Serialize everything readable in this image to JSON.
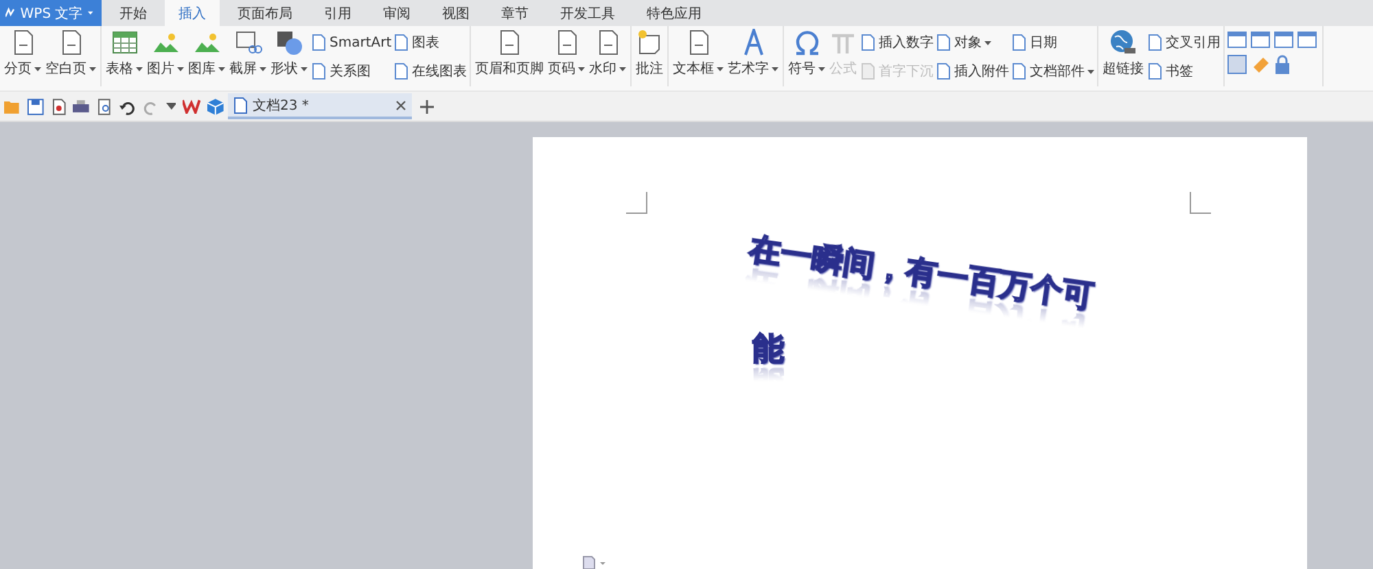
{
  "app_button": {
    "label": "WPS 文字",
    "dropdown": true
  },
  "tabs": [
    {
      "label": "开始",
      "selected": false
    },
    {
      "label": "插入",
      "selected": true
    },
    {
      "label": "页面布局",
      "selected": false
    },
    {
      "label": "引用",
      "selected": false
    },
    {
      "label": "审阅",
      "selected": false
    },
    {
      "label": "视图",
      "selected": false
    },
    {
      "label": "章节",
      "selected": false
    },
    {
      "label": "开发工具",
      "selected": false
    },
    {
      "label": "特色应用",
      "selected": false
    }
  ],
  "ribbon": {
    "groups": [
      {
        "columns": [
          {
            "kind": "large",
            "label": "分页",
            "dropdown": true,
            "disabled": false
          },
          {
            "kind": "large",
            "label": "空白页",
            "dropdown": true,
            "disabled": false
          }
        ]
      },
      {
        "columns": [
          {
            "kind": "large",
            "label": "表格",
            "dropdown": true,
            "disabled": false
          },
          {
            "kind": "large",
            "label": "图片",
            "dropdown": true,
            "disabled": false
          },
          {
            "kind": "large",
            "label": "图库",
            "dropdown": true,
            "disabled": false
          },
          {
            "kind": "large",
            "label": "截屏",
            "dropdown": true,
            "disabled": false
          },
          {
            "kind": "large",
            "label": "形状",
            "dropdown": true,
            "disabled": false
          },
          {
            "kind": "stack",
            "items": [
              {
                "label": "SmartArt",
                "dropdown": false,
                "disabled": false
              },
              {
                "label": "关系图",
                "dropdown": false,
                "disabled": false
              }
            ]
          },
          {
            "kind": "stack",
            "items": [
              {
                "label": "图表",
                "dropdown": false,
                "disabled": false
              },
              {
                "label": "在线图表",
                "dropdown": false,
                "disabled": false
              }
            ]
          }
        ]
      },
      {
        "columns": [
          {
            "kind": "large",
            "label": "页眉和页脚",
            "dropdown": false,
            "disabled": false
          },
          {
            "kind": "large",
            "label": "页码",
            "dropdown": true,
            "disabled": false
          },
          {
            "kind": "large",
            "label": "水印",
            "dropdown": true,
            "disabled": false
          }
        ]
      },
      {
        "columns": [
          {
            "kind": "large",
            "label": "批注",
            "dropdown": false,
            "disabled": false
          }
        ]
      },
      {
        "columns": [
          {
            "kind": "large",
            "label": "文本框",
            "dropdown": true,
            "disabled": false
          },
          {
            "kind": "large",
            "label": "艺术字",
            "dropdown": true,
            "disabled": false
          }
        ]
      },
      {
        "columns": [
          {
            "kind": "large",
            "label": "符号",
            "dropdown": true,
            "disabled": false
          },
          {
            "kind": "large",
            "label": "公式",
            "dropdown": false,
            "disabled": true
          },
          {
            "kind": "stack",
            "items": [
              {
                "label": "插入数字",
                "dropdown": false,
                "disabled": false
              },
              {
                "label": "首字下沉",
                "dropdown": false,
                "disabled": true
              }
            ]
          },
          {
            "kind": "stack",
            "items": [
              {
                "label": "对象",
                "dropdown": true,
                "disabled": false
              },
              {
                "label": "插入附件",
                "dropdown": false,
                "disabled": false
              }
            ]
          },
          {
            "kind": "stack",
            "items": [
              {
                "label": "日期",
                "dropdown": false,
                "disabled": false
              },
              {
                "label": "文档部件",
                "dropdown": true,
                "disabled": false
              }
            ]
          }
        ]
      },
      {
        "columns": [
          {
            "kind": "large",
            "label": "超链接",
            "dropdown": false,
            "disabled": false
          },
          {
            "kind": "stack",
            "items": [
              {
                "label": "交叉引用",
                "dropdown": false,
                "disabled": false
              },
              {
                "label": "书签",
                "dropdown": false,
                "disabled": false
              }
            ]
          }
        ]
      },
      {
        "columns": [
          {
            "kind": "icons"
          }
        ]
      }
    ]
  },
  "document_tab": {
    "title": "文档23 *"
  },
  "document": {
    "wordart_lines": [
      "在一瞬间，有一百万个可",
      "能"
    ]
  }
}
